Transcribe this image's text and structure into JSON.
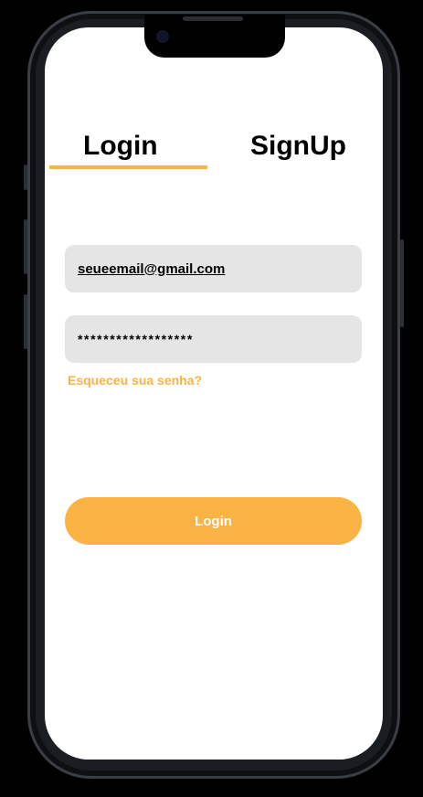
{
  "tabs": {
    "login_label": "Login",
    "signup_label": "SignUp",
    "active": "login"
  },
  "form": {
    "email_value": "seueemail@gmail.com",
    "password_value": "******************",
    "forgot_label": "Esqueceu sua senha?"
  },
  "submit": {
    "label": "Login"
  },
  "colors": {
    "accent": "#fbb343",
    "field_bg": "#e5e5e5",
    "screen_bg": "#ffffff"
  }
}
